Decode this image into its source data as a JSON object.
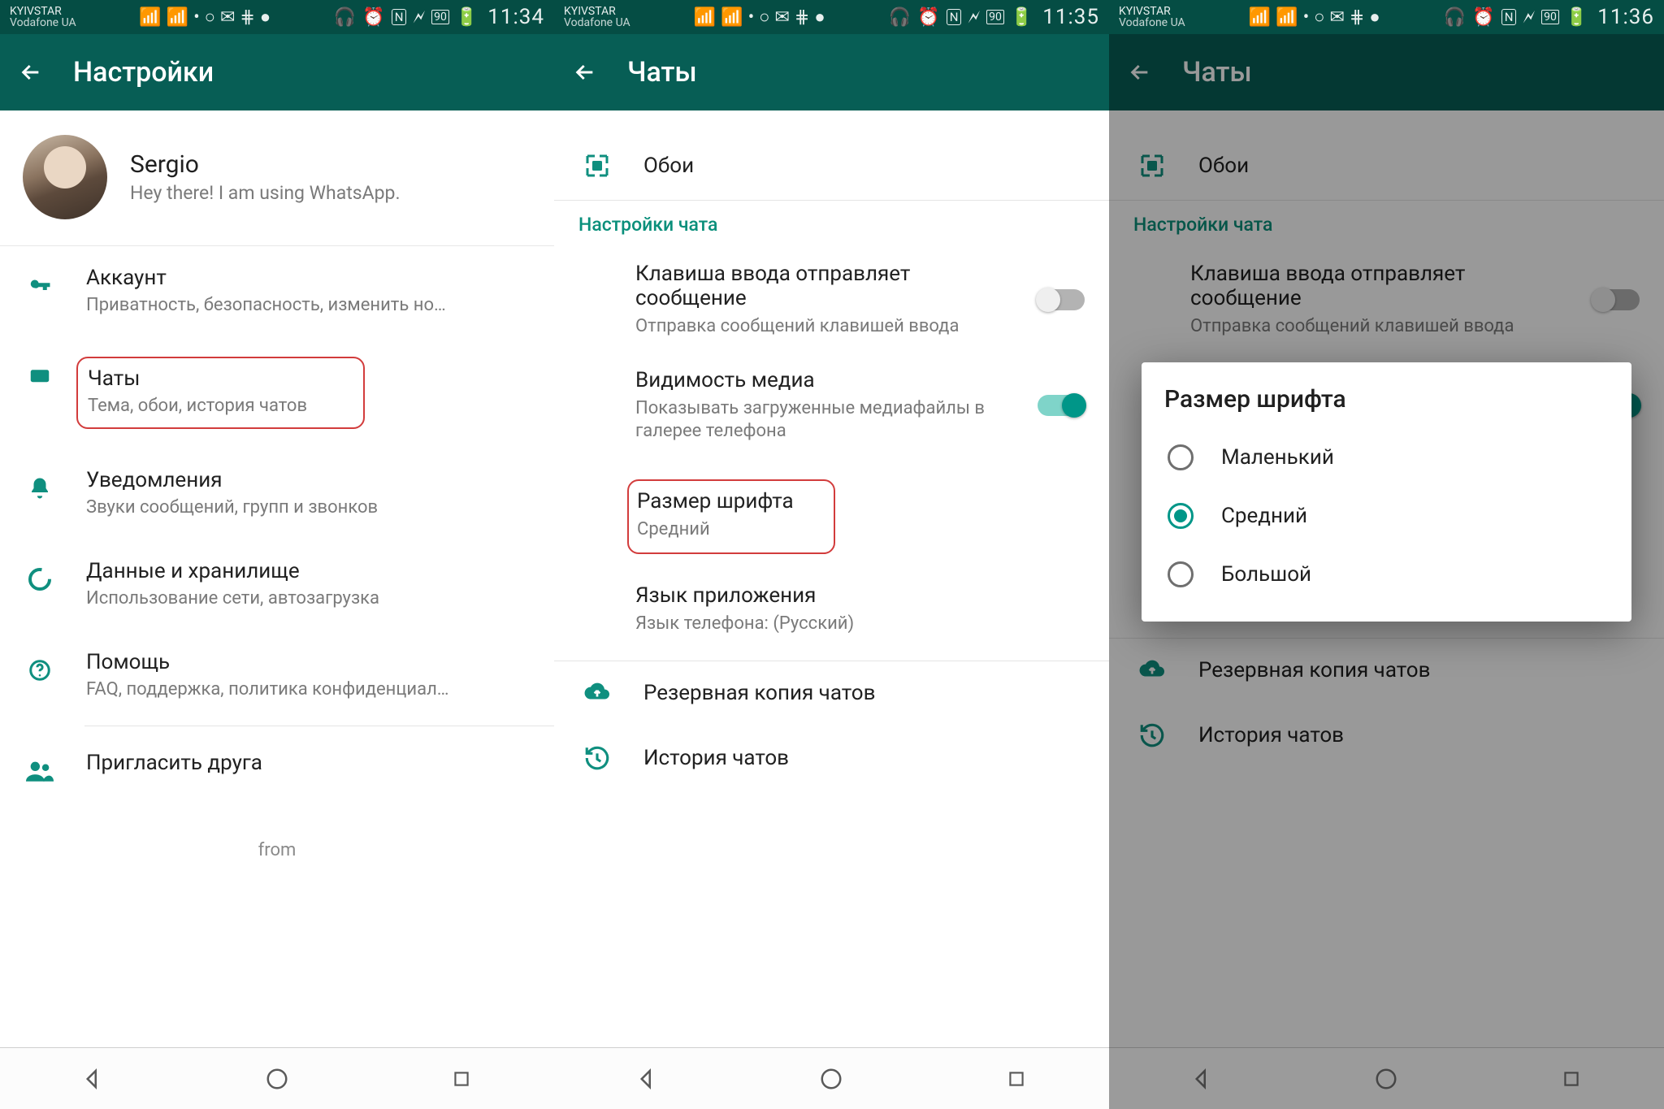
{
  "status": {
    "carrier1": "KYIVSTAR",
    "carrier2": "Vodafone UA",
    "battery": "90",
    "time1": "11:34",
    "time2": "11:35",
    "time3": "11:36"
  },
  "screen1": {
    "title": "Настройки",
    "profile": {
      "name": "Sergio",
      "status": "Hey there! I am using WhatsApp."
    },
    "items": [
      {
        "title": "Аккаунт",
        "sub": "Приватность, безопасность, изменить но…"
      },
      {
        "title": "Чаты",
        "sub": "Тема, обои, история чатов"
      },
      {
        "title": "Уведомления",
        "sub": "Звуки сообщений, групп и звонков"
      },
      {
        "title": "Данные и хранилище",
        "sub": "Использование сети, автозагрузка"
      },
      {
        "title": "Помощь",
        "sub": "FAQ, поддержка, политика конфиденциал…"
      },
      {
        "title": "Пригласить друга",
        "sub": ""
      }
    ],
    "from": "from"
  },
  "screen2": {
    "title": "Чаты",
    "wallpaper": "Обои",
    "section": "Настройки чата",
    "enterSend": {
      "title": "Клавиша ввода отправляет сообщение",
      "sub": "Отправка сообщений клавишей ввода"
    },
    "media": {
      "title": "Видимость медиа",
      "sub": "Показывать загруженные медиафайлы в галерее телефона"
    },
    "fontSize": {
      "title": "Размер шрифта",
      "value": "Средний"
    },
    "appLang": {
      "title": "Язык приложения",
      "value": "Язык телефона: (Русский)"
    },
    "backup": "Резервная копия чатов",
    "history": "История чатов"
  },
  "dialog": {
    "title": "Размер шрифта",
    "options": [
      "Маленький",
      "Средний",
      "Большой"
    ],
    "selectedIndex": 1
  }
}
